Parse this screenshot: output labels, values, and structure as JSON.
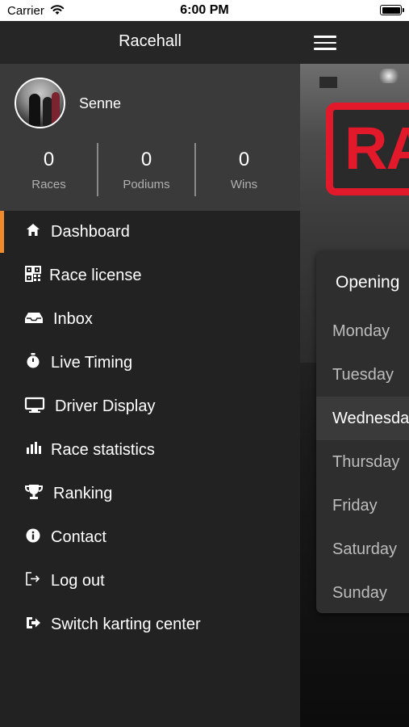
{
  "status_bar": {
    "carrier": "Carrier",
    "time": "6:00 PM"
  },
  "drawer": {
    "title": "Racehall",
    "user": {
      "name": "Senne"
    },
    "stats": [
      {
        "value": "0",
        "label": "Races"
      },
      {
        "value": "0",
        "label": "Podiums"
      },
      {
        "value": "0",
        "label": "Wins"
      }
    ],
    "menu": [
      {
        "label": "Dashboard",
        "icon": "home-icon",
        "active": true
      },
      {
        "label": "Race license",
        "icon": "qr-code-icon"
      },
      {
        "label": "Inbox",
        "icon": "inbox-tray-icon"
      },
      {
        "label": "Live Timing",
        "icon": "stopwatch-icon"
      },
      {
        "label": "Driver Display",
        "icon": "monitor-icon"
      },
      {
        "label": "Race statistics",
        "icon": "bar-chart-icon"
      },
      {
        "label": "Ranking",
        "icon": "trophy-icon"
      },
      {
        "label": "Contact",
        "icon": "info-icon"
      },
      {
        "label": "Log out",
        "icon": "logout-icon"
      },
      {
        "label": "Switch karting center",
        "icon": "switch-center-icon"
      }
    ],
    "accent_color": "#f08a2a"
  },
  "main": {
    "logo_text": "RA",
    "logo_color": "#e2192a",
    "opening_hours": {
      "title": "Opening",
      "days": [
        "Monday",
        "Tuesday",
        "Wednesday",
        "Thursday",
        "Friday",
        "Saturday",
        "Sunday"
      ],
      "highlighted": "Wednesday"
    }
  }
}
